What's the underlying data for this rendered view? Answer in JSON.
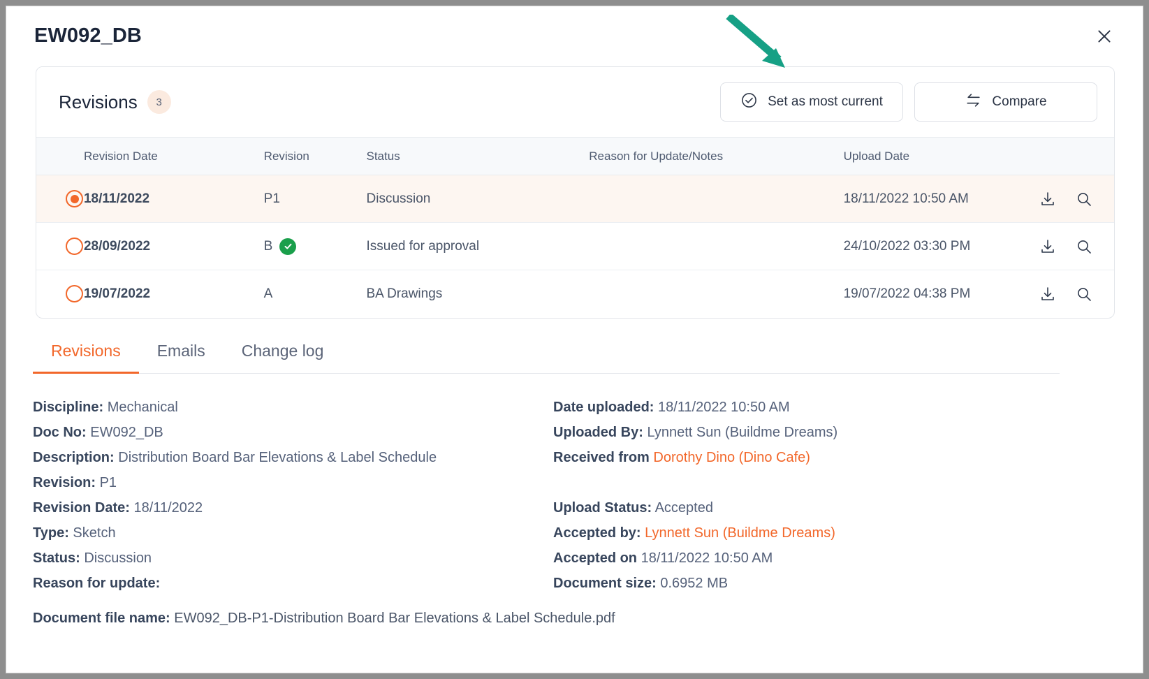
{
  "window": {
    "title": "EW092_DB",
    "close_icon": "close-icon"
  },
  "revisions_card": {
    "heading": "Revisions",
    "count": "3",
    "buttons": {
      "set_current": "Set as most current",
      "set_current_icon": "check-circle-icon",
      "compare": "Compare",
      "compare_icon": "swap-arrows-icon"
    },
    "columns": [
      "Revision Date",
      "Revision",
      "Status",
      "Reason for Update/Notes",
      "Upload Date"
    ],
    "rows": [
      {
        "selected": true,
        "revision_date": "18/11/2022",
        "revision": "P1",
        "approved": false,
        "status": "Discussion",
        "notes": "",
        "upload_date": "18/11/2022 10:50 AM",
        "download_icon": "download-icon",
        "preview_icon": "search-icon"
      },
      {
        "selected": false,
        "revision_date": "28/09/2022",
        "revision": "B",
        "approved": true,
        "status": "Issued for approval",
        "notes": "",
        "upload_date": "24/10/2022 03:30 PM",
        "download_icon": "download-icon",
        "preview_icon": "search-icon"
      },
      {
        "selected": false,
        "revision_date": "19/07/2022",
        "revision": "A",
        "approved": false,
        "status": "BA Drawings",
        "notes": "",
        "upload_date": "19/07/2022 04:38 PM",
        "download_icon": "download-icon",
        "preview_icon": "search-icon"
      }
    ]
  },
  "tabs": [
    {
      "label": "Revisions",
      "active": true
    },
    {
      "label": "Emails",
      "active": false
    },
    {
      "label": "Change log",
      "active": false
    }
  ],
  "details": {
    "left": [
      {
        "key": "Discipline:",
        "value": "Mechanical",
        "link": false
      },
      {
        "key": "Doc No:",
        "value": "EW092_DB",
        "link": false
      },
      {
        "key": "Description:",
        "value": "Distribution Board Bar Elevations & Label Schedule",
        "link": false
      },
      {
        "key": "Revision:",
        "value": "P1",
        "link": false
      },
      {
        "key": "Revision Date:",
        "value": "18/11/2022",
        "link": false
      },
      {
        "key": "Type:",
        "value": "Sketch",
        "link": false
      },
      {
        "key": "Status:",
        "value": "Discussion",
        "link": false
      },
      {
        "key": "Reason for update:",
        "value": "",
        "link": false
      }
    ],
    "right": [
      {
        "key": "Date uploaded:",
        "value": "18/11/2022 10:50 AM",
        "link": false
      },
      {
        "key": "Uploaded By:",
        "value": "Lynnett Sun (Buildme Dreams)",
        "link": false
      },
      {
        "key": "Received from",
        "value": "Dorothy Dino (Dino Cafe)",
        "link": true
      },
      {
        "key": "",
        "value": "",
        "link": false
      },
      {
        "key": "Upload Status:",
        "value": "Accepted",
        "link": false
      },
      {
        "key": "Accepted by:",
        "value": "Lynnett Sun (Buildme Dreams)",
        "link": true
      },
      {
        "key": "Accepted on",
        "value": "18/11/2022 10:50 AM",
        "link": false
      },
      {
        "key": "Document size:",
        "value": "0.6952 MB",
        "link": false
      }
    ],
    "footer": {
      "key": "Document file name:",
      "value": "EW092_DB-P1-Distribution Board Bar Elevations & Label Schedule.pdf"
    }
  },
  "colors": {
    "accent_orange": "#f2672a",
    "approved_green": "#1a9f4b",
    "annotation_teal": "#16a085",
    "title_navy": "#1b2539"
  }
}
